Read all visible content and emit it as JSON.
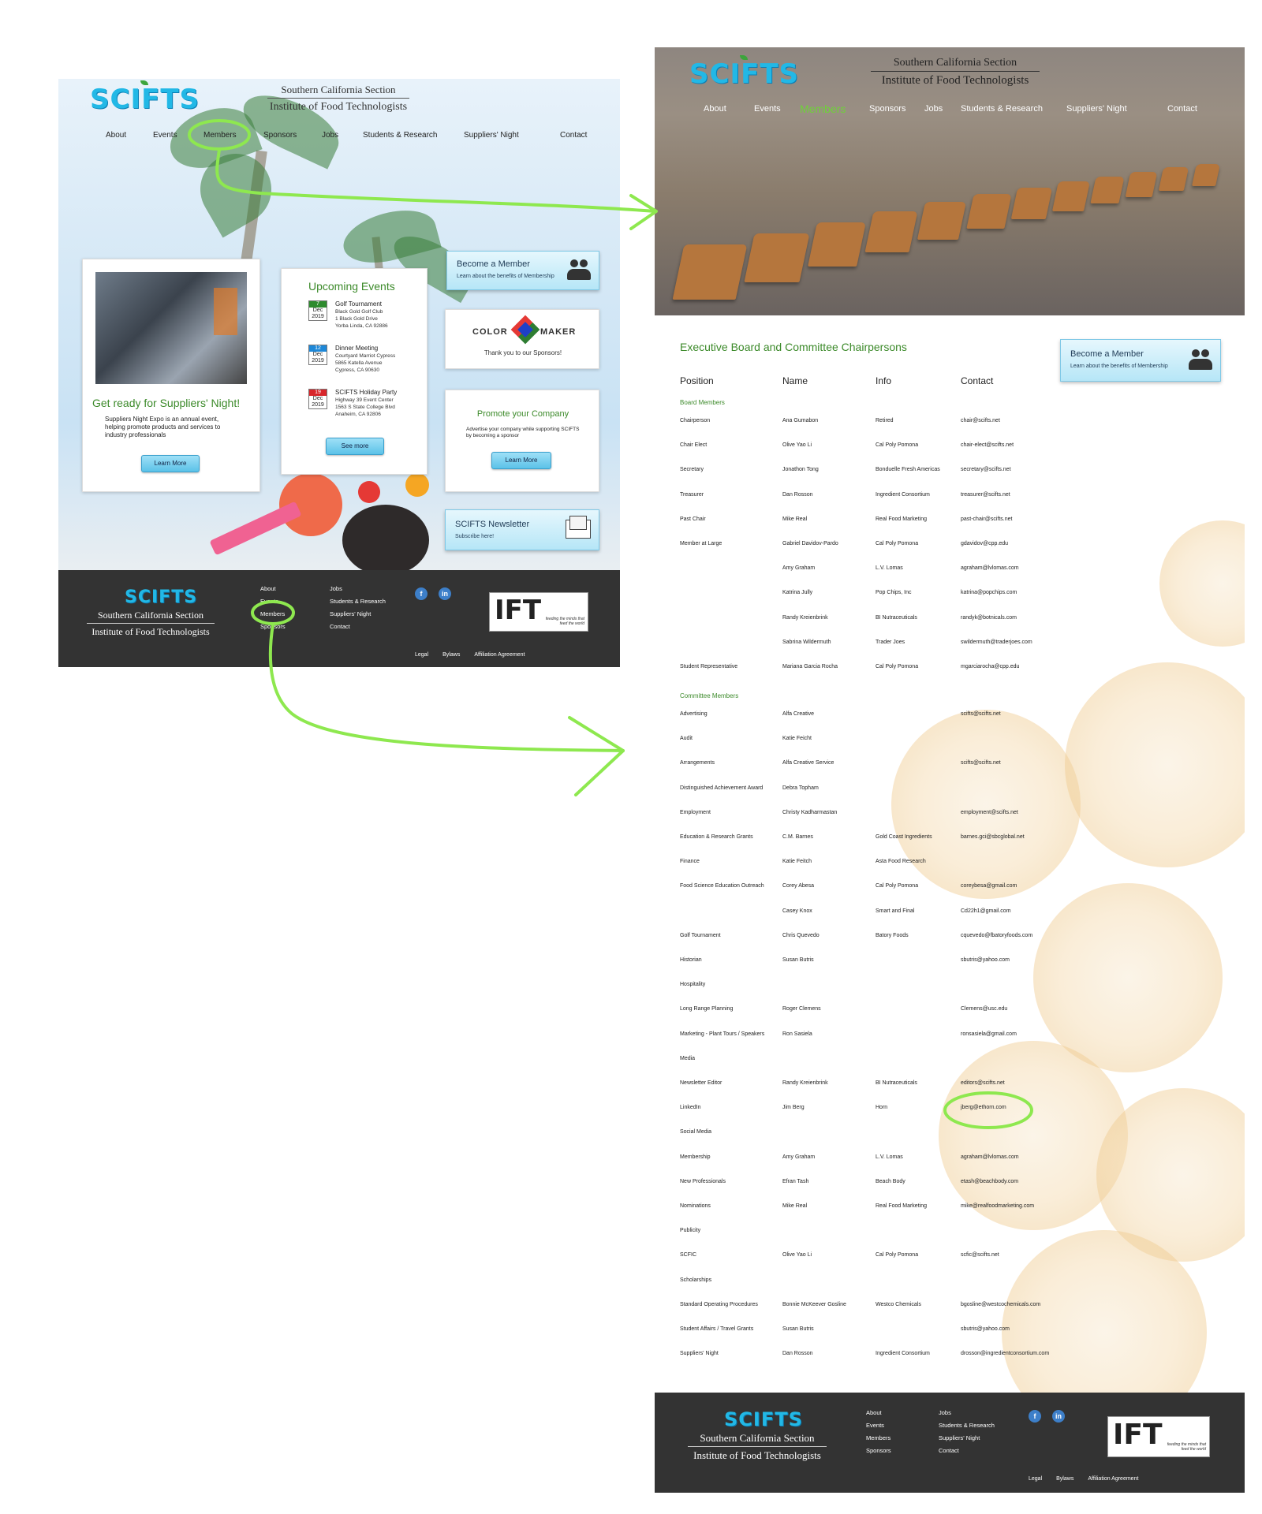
{
  "left_page": {
    "logo": "SCIFTS",
    "org_line1": "Southern California Section",
    "org_line2": "Institute of Food Technologists",
    "nav": [
      "About",
      "Events",
      "Members",
      "Sponsors",
      "Jobs",
      "Students & Research",
      "Suppliers' Night",
      "Contact"
    ],
    "suppliers_card": {
      "title": "Get ready for Suppliers' Night!",
      "text": "Suppliers Night Expo is an annual event, helping promote products and services to industry professionals",
      "button": "Learn More"
    },
    "events_card": {
      "title": "Upcoming Events",
      "events": [
        {
          "day": "7",
          "month": "Dec",
          "year": "2019",
          "name": "Golf Tournament",
          "line1": "Black Gold Golf Club",
          "line2": "1 Black Gold Drive",
          "line3": "Yorba Linda, CA 92886",
          "color": "#2e8b2e"
        },
        {
          "day": "12",
          "month": "Dec",
          "year": "2019",
          "name": "Dinner Meeting",
          "line1": "Courtyard Marriot Cypress",
          "line2": "5865 Katella Avenue",
          "line3": "Cypress, CA 90630",
          "color": "#1e88d8"
        },
        {
          "day": "19",
          "month": "Dec",
          "year": "2019",
          "name": "SCIFTS Holiday Party",
          "line1": "Highway 39 Event Center",
          "line2": "1563 S State College Blvd",
          "line3": "Anaheim, CA 92806",
          "color": "#d8262b"
        }
      ],
      "button": "See more"
    },
    "member_card": {
      "title": "Become a Member",
      "subtitle": "Learn about the benefits of Membership"
    },
    "sponsor_card": {
      "brand_left": "COLOR",
      "brand_right": "MAKER",
      "text": "Thank you to our Sponsors!"
    },
    "promote_card": {
      "title": "Promote your Company",
      "text": "Advertise your company while supporting SCIFTS by becoming a sponsor",
      "button": "Learn More"
    },
    "newsletter_card": {
      "title": "SCIFTS Newsletter",
      "subtitle": "Subscribe here!"
    },
    "footer": {
      "logo": "SCIFTS",
      "org_line1": "Southern California Section",
      "org_line2": "Institute of Food Technologists",
      "links_col1": [
        "About",
        "Events",
        "Members",
        "Sponsors"
      ],
      "links_col2": [
        "Jobs",
        "Students & Research",
        "Suppliers' Night",
        "Contact"
      ],
      "legal": [
        "Legal",
        "Bylaws",
        "Affiliation Agreement"
      ],
      "ift": "IFT",
      "ift_tagline": "feeding the minds that feed the world"
    }
  },
  "right_page": {
    "logo": "SCIFTS",
    "org_line1": "Southern California Section",
    "org_line2": "Institute of Food Technologists",
    "nav": [
      "About",
      "Events",
      "Members",
      "Sponsors",
      "Jobs",
      "Students & Research",
      "Suppliers' Night",
      "Contact"
    ],
    "section_title": "Executive Board and Committee Chairpersons",
    "member_card": {
      "title": "Become a Member",
      "subtitle": "Learn about the benefits of Membership"
    },
    "columns": [
      "Position",
      "Name",
      "Info",
      "Contact"
    ],
    "board_heading": "Board Members",
    "board": [
      [
        "Chairperson",
        "Ana Gumabon",
        "Retired",
        "chair@scifts.net"
      ],
      [
        "Chair Elect",
        "Olive Yao Li",
        "Cal Poly Pomona",
        "chair-elect@scifts.net"
      ],
      [
        "Secretary",
        "Jonathon Tong",
        "Bonduelle Fresh Americas",
        "secretary@scifts.net"
      ],
      [
        "Treasurer",
        "Dan Rosson",
        "Ingredient Consortium",
        "treasurer@scifts.net"
      ],
      [
        "Past Chair",
        "Mike Real",
        "Real Food Marketing",
        "past-chair@scifts.net"
      ],
      [
        "Member at Large",
        "Gabriel Davidov-Pardo",
        "Cal Poly Pomona",
        "gdavidov@cpp.edu"
      ],
      [
        "",
        "Amy Graham",
        "L.V. Lomas",
        "agraham@lvlomas.com"
      ],
      [
        "",
        "Katrina Jully",
        "Pop Chips, Inc",
        "katrina@popchips.com"
      ],
      [
        "",
        "Randy Kreienbrink",
        "BI Nutraceuticals",
        "randyk@botnicals.com"
      ],
      [
        "",
        "Sabrina Wildermuth",
        "Trader Joes",
        "swildermuth@traderjoes.com"
      ],
      [
        "Student Representative",
        "Mariana Garcia Rocha",
        "Cal Poly Pomona",
        "mgarciarocha@cpp.edu"
      ]
    ],
    "committee_heading": "Committee Members",
    "committee": [
      [
        "Advertising",
        "Alfa Creative",
        "",
        "scifts@scifts.net"
      ],
      [
        "Audit",
        "Katie Feicht",
        "",
        ""
      ],
      [
        "Arrangements",
        "Alfa Creative Service",
        "",
        "scifts@scifts.net"
      ],
      [
        "Distinguished Achievement Award",
        "Debra Topham",
        "",
        ""
      ],
      [
        "Employment",
        "Christy Kadharmastan",
        "",
        "employment@scifts.net"
      ],
      [
        "Education & Research Grants",
        "C.M. Barnes",
        "Gold Coast Ingredients",
        "barnes.gci@sbcglobal.net"
      ],
      [
        "Finance",
        "Katie Feitch",
        "Asta Food Research",
        ""
      ],
      [
        "Food Science Education Outreach",
        "Corey Abesa",
        "Cal Poly Pomona",
        "coreybesa@gmail.com"
      ],
      [
        "",
        "Casey Knox",
        "Smart and Final",
        "Cd22h1@gmail.com"
      ],
      [
        "Golf Tournament",
        "Chris Quevedo",
        "Batory Foods",
        "cquevedo@fbatoryfoods.com"
      ],
      [
        "Historian",
        "Susan Butris",
        "",
        "sbutris@yahoo.com"
      ],
      [
        "Hospitality",
        "",
        "",
        ""
      ],
      [
        "Long Range Planning",
        "Roger Clemens",
        "",
        "Clemens@usc.edu"
      ],
      [
        "Marketing - Plant Tours / Speakers",
        "Ron Sasiela",
        "",
        "ronsasiela@gmail.com"
      ],
      [
        "Media",
        "",
        "",
        ""
      ],
      [
        "Newsletter Editor",
        "Randy Kreienbrink",
        "BI Nutraceuticals",
        "editors@scifts.net"
      ],
      [
        "LinkedIn",
        "Jim Berg",
        "Horn",
        "jberg@ethorn.com"
      ],
      [
        "Social Media",
        "",
        "",
        ""
      ],
      [
        "Membership",
        "Amy Graham",
        "L.V. Lomas",
        "agraham@lvlomas.com"
      ],
      [
        "New Professionals",
        "Efran Tash",
        "Beach Body",
        "etash@beachbody.com"
      ],
      [
        "Nominations",
        "Mike Real",
        "Real Food Marketing",
        "mike@realfoodmarketing.com"
      ],
      [
        "Publicity",
        "",
        "",
        ""
      ],
      [
        "SCFIC",
        "Olive Yao Li",
        "Cal Poly Pomona",
        "scfic@scifts.net"
      ],
      [
        "Scholarships",
        "",
        "",
        ""
      ],
      [
        "Standard Operating Procedures",
        "Bonnie McKeever Gosline",
        "Westco Chemicals",
        "bgosline@westcochemicals.com"
      ],
      [
        "Student Affairs / Travel Grants",
        "Susan Butris",
        "",
        "sbutris@yahoo.com"
      ],
      [
        "Suppliers' Night",
        "Dan Rosson",
        "Ingredient Consortium",
        "drosson@ingredientconsortium.com"
      ]
    ],
    "footer": {
      "logo": "SCIFTS",
      "org_line1": "Southern California Section",
      "org_line2": "Institute of Food Technologists",
      "links_col1": [
        "About",
        "Events",
        "Members",
        "Sponsors"
      ],
      "links_col2": [
        "Jobs",
        "Students & Research",
        "Suppliers' Night",
        "Contact"
      ],
      "legal": [
        "Legal",
        "Bylaws",
        "Affiliation Agreement"
      ],
      "ift": "IFT",
      "ift_tagline": "feeding the minds that feed the world"
    }
  },
  "colors": {
    "accent_green": "#3c8a2a",
    "annotation_green": "#8ee84f",
    "logo_blue": "#22b8e6",
    "footer_bg": "#333333"
  }
}
